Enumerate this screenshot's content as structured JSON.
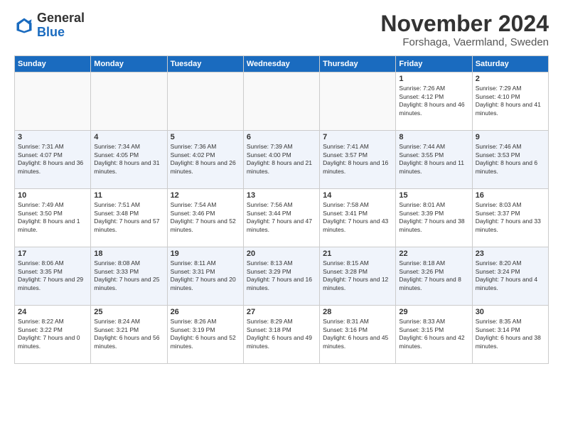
{
  "header": {
    "logo_general": "General",
    "logo_blue": "Blue",
    "title": "November 2024",
    "location": "Forshaga, Vaermland, Sweden"
  },
  "weekdays": [
    "Sunday",
    "Monday",
    "Tuesday",
    "Wednesday",
    "Thursday",
    "Friday",
    "Saturday"
  ],
  "weeks": [
    [
      {
        "day": "",
        "info": ""
      },
      {
        "day": "",
        "info": ""
      },
      {
        "day": "",
        "info": ""
      },
      {
        "day": "",
        "info": ""
      },
      {
        "day": "",
        "info": ""
      },
      {
        "day": "1",
        "info": "Sunrise: 7:26 AM\nSunset: 4:12 PM\nDaylight: 8 hours and 46 minutes."
      },
      {
        "day": "2",
        "info": "Sunrise: 7:29 AM\nSunset: 4:10 PM\nDaylight: 8 hours and 41 minutes."
      }
    ],
    [
      {
        "day": "3",
        "info": "Sunrise: 7:31 AM\nSunset: 4:07 PM\nDaylight: 8 hours and 36 minutes."
      },
      {
        "day": "4",
        "info": "Sunrise: 7:34 AM\nSunset: 4:05 PM\nDaylight: 8 hours and 31 minutes."
      },
      {
        "day": "5",
        "info": "Sunrise: 7:36 AM\nSunset: 4:02 PM\nDaylight: 8 hours and 26 minutes."
      },
      {
        "day": "6",
        "info": "Sunrise: 7:39 AM\nSunset: 4:00 PM\nDaylight: 8 hours and 21 minutes."
      },
      {
        "day": "7",
        "info": "Sunrise: 7:41 AM\nSunset: 3:57 PM\nDaylight: 8 hours and 16 minutes."
      },
      {
        "day": "8",
        "info": "Sunrise: 7:44 AM\nSunset: 3:55 PM\nDaylight: 8 hours and 11 minutes."
      },
      {
        "day": "9",
        "info": "Sunrise: 7:46 AM\nSunset: 3:53 PM\nDaylight: 8 hours and 6 minutes."
      }
    ],
    [
      {
        "day": "10",
        "info": "Sunrise: 7:49 AM\nSunset: 3:50 PM\nDaylight: 8 hours and 1 minute."
      },
      {
        "day": "11",
        "info": "Sunrise: 7:51 AM\nSunset: 3:48 PM\nDaylight: 7 hours and 57 minutes."
      },
      {
        "day": "12",
        "info": "Sunrise: 7:54 AM\nSunset: 3:46 PM\nDaylight: 7 hours and 52 minutes."
      },
      {
        "day": "13",
        "info": "Sunrise: 7:56 AM\nSunset: 3:44 PM\nDaylight: 7 hours and 47 minutes."
      },
      {
        "day": "14",
        "info": "Sunrise: 7:58 AM\nSunset: 3:41 PM\nDaylight: 7 hours and 43 minutes."
      },
      {
        "day": "15",
        "info": "Sunrise: 8:01 AM\nSunset: 3:39 PM\nDaylight: 7 hours and 38 minutes."
      },
      {
        "day": "16",
        "info": "Sunrise: 8:03 AM\nSunset: 3:37 PM\nDaylight: 7 hours and 33 minutes."
      }
    ],
    [
      {
        "day": "17",
        "info": "Sunrise: 8:06 AM\nSunset: 3:35 PM\nDaylight: 7 hours and 29 minutes."
      },
      {
        "day": "18",
        "info": "Sunrise: 8:08 AM\nSunset: 3:33 PM\nDaylight: 7 hours and 25 minutes."
      },
      {
        "day": "19",
        "info": "Sunrise: 8:11 AM\nSunset: 3:31 PM\nDaylight: 7 hours and 20 minutes."
      },
      {
        "day": "20",
        "info": "Sunrise: 8:13 AM\nSunset: 3:29 PM\nDaylight: 7 hours and 16 minutes."
      },
      {
        "day": "21",
        "info": "Sunrise: 8:15 AM\nSunset: 3:28 PM\nDaylight: 7 hours and 12 minutes."
      },
      {
        "day": "22",
        "info": "Sunrise: 8:18 AM\nSunset: 3:26 PM\nDaylight: 7 hours and 8 minutes."
      },
      {
        "day": "23",
        "info": "Sunrise: 8:20 AM\nSunset: 3:24 PM\nDaylight: 7 hours and 4 minutes."
      }
    ],
    [
      {
        "day": "24",
        "info": "Sunrise: 8:22 AM\nSunset: 3:22 PM\nDaylight: 7 hours and 0 minutes."
      },
      {
        "day": "25",
        "info": "Sunrise: 8:24 AM\nSunset: 3:21 PM\nDaylight: 6 hours and 56 minutes."
      },
      {
        "day": "26",
        "info": "Sunrise: 8:26 AM\nSunset: 3:19 PM\nDaylight: 6 hours and 52 minutes."
      },
      {
        "day": "27",
        "info": "Sunrise: 8:29 AM\nSunset: 3:18 PM\nDaylight: 6 hours and 49 minutes."
      },
      {
        "day": "28",
        "info": "Sunrise: 8:31 AM\nSunset: 3:16 PM\nDaylight: 6 hours and 45 minutes."
      },
      {
        "day": "29",
        "info": "Sunrise: 8:33 AM\nSunset: 3:15 PM\nDaylight: 6 hours and 42 minutes."
      },
      {
        "day": "30",
        "info": "Sunrise: 8:35 AM\nSunset: 3:14 PM\nDaylight: 6 hours and 38 minutes."
      }
    ]
  ]
}
